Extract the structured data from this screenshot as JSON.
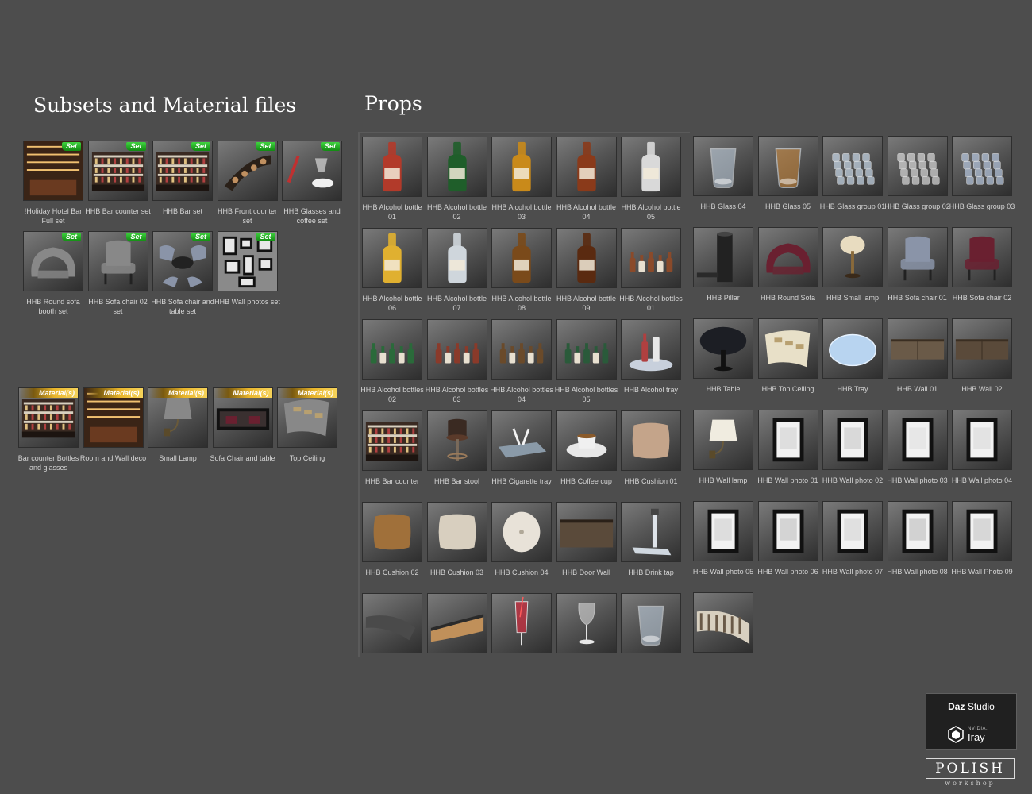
{
  "subsets_title": "Subsets and Material files",
  "props_title": "Props",
  "subsets": [
    {
      "label": "!Holiday Hotel Bar Full set",
      "badge": "Set",
      "icon": "bar-room-icon"
    },
    {
      "label": "HHB Bar counter set",
      "badge": "Set",
      "icon": "bar-counter-icon"
    },
    {
      "label": "HHB Bar set",
      "badge": "Set",
      "icon": "bar-counter-icon"
    },
    {
      "label": "HHB Front counter set",
      "badge": "Set",
      "icon": "front-counter-icon"
    },
    {
      "label": "HHB Glasses and coffee set",
      "badge": "Set",
      "icon": "glasses-coffee-icon"
    },
    {
      "label": "HHB Round sofa booth set",
      "badge": "Set",
      "icon": "sofa-icon"
    },
    {
      "label": "HHB Sofa chair 02 set",
      "badge": "Set",
      "icon": "chair-icon"
    },
    {
      "label": "HHB Sofa chair and table set",
      "badge": "Set",
      "icon": "chair-table-icon"
    },
    {
      "label": "HHB Wall photos set",
      "badge": "Set",
      "icon": "wall-photos-icon"
    }
  ],
  "materials": [
    {
      "label": "Bar counter Bottles and glasses",
      "badge": "Material(s)",
      "icon": "bar-counter-icon"
    },
    {
      "label": "Room and Wall deco",
      "badge": "Material(s)",
      "icon": "bar-room-icon"
    },
    {
      "label": "Small Lamp",
      "badge": "Material(s)",
      "icon": "wall-lamp-icon"
    },
    {
      "label": "Sofa Chair and table",
      "badge": "Material(s)",
      "icon": "sofa-table-icon"
    },
    {
      "label": "Top Ceiling",
      "badge": "Material(s)",
      "icon": "ceiling-icon"
    }
  ],
  "props_left": [
    {
      "label": "HHB Alcohol bottle 01",
      "icon": "bottle-icon",
      "color": "#b23a2a"
    },
    {
      "label": "HHB Alcohol bottle 02",
      "icon": "bottle-icon",
      "color": "#1f5e2a"
    },
    {
      "label": "HHB Alcohol bottle 03",
      "icon": "bottle-icon",
      "color": "#c98a1a"
    },
    {
      "label": "HHB Alcohol bottle 04",
      "icon": "bottle-icon",
      "color": "#8a3a1a"
    },
    {
      "label": "HHB Alcohol bottle 05",
      "icon": "bottle-icon",
      "color": "#d9d9d9"
    },
    {
      "label": "HHB Alcohol bottle 06",
      "icon": "bottle-icon",
      "color": "#e0b030"
    },
    {
      "label": "HHB Alcohol bottle 07",
      "icon": "bottle-icon",
      "color": "#cfd6dc"
    },
    {
      "label": "HHB Alcohol bottle 08",
      "icon": "bottle-icon",
      "color": "#7a4a1a"
    },
    {
      "label": "HHB Alcohol bottle 09",
      "icon": "bottle-icon",
      "color": "#5a2a10"
    },
    {
      "label": "HHB Alcohol bottles 01",
      "icon": "bottles-icon",
      "color": "#8a4a2a"
    },
    {
      "label": "HHB Alcohol bottles 02",
      "icon": "bottles-icon",
      "color": "#2a6a3a"
    },
    {
      "label": "HHB Alcohol bottles 03",
      "icon": "bottles-icon",
      "color": "#8a3a2a"
    },
    {
      "label": "HHB Alcohol bottles 04",
      "icon": "bottles-icon",
      "color": "#6a4a2a"
    },
    {
      "label": "HHB Alcohol bottles 05",
      "icon": "bottles-icon",
      "color": "#2a5a3a"
    },
    {
      "label": "HHB Alcohol tray",
      "icon": "tray-bottles-icon",
      "color": "#b04040"
    },
    {
      "label": "HHB Bar counter",
      "icon": "bar-counter-icon",
      "color": "#a06a3a"
    },
    {
      "label": "HHB Bar stool",
      "icon": "bar-stool-icon",
      "color": "#3a2a22"
    },
    {
      "label": "HHB Cigarette tray",
      "icon": "cigarette-tray-icon",
      "color": "#8a9aa8"
    },
    {
      "label": "HHB Coffee cup",
      "icon": "coffee-cup-icon",
      "color": "#f0f0f0"
    },
    {
      "label": "HHB Cushion 01",
      "icon": "cushion-icon",
      "color": "#c4a48a"
    },
    {
      "label": "HHB Cushion 02",
      "icon": "cushion-icon",
      "color": "#a0703a"
    },
    {
      "label": "HHB Cushion 03",
      "icon": "cushion-icon",
      "color": "#d8cfbf"
    },
    {
      "label": "HHB Cushion 04",
      "icon": "round-cushion-icon",
      "color": "#e8e2d8"
    },
    {
      "label": "HHB Door Wall",
      "icon": "door-wall-icon",
      "color": "#5a4a3a"
    },
    {
      "label": "HHB Drink tap",
      "icon": "drink-tap-icon",
      "color": "#d0d8e0"
    },
    {
      "label": "",
      "icon": "curved-panel-icon",
      "color": "#4a4a4a"
    },
    {
      "label": "",
      "icon": "curved-counter-icon",
      "color": "#c0905a"
    },
    {
      "label": "",
      "icon": "cocktail-glass-icon",
      "color": "#c03040"
    },
    {
      "label": "",
      "icon": "wine-glass-icon",
      "color": "#d8d8d8"
    },
    {
      "label": "",
      "icon": "glass-icon",
      "color": "#c8d8e8"
    }
  ],
  "props_right": [
    {
      "label": "HHB Glass 04",
      "icon": "glass-icon",
      "color": "#c8d8e8"
    },
    {
      "label": "HHB Glass 05",
      "icon": "glass-icon",
      "color": "#d08a3a"
    },
    {
      "label": "HHB Glass group 01",
      "icon": "glass-group-icon",
      "color": "#c8d8e8"
    },
    {
      "label": "HHB Glass group 02",
      "icon": "glass-group-icon",
      "color": "#d8d8d8"
    },
    {
      "label": "HHB Glass group 03",
      "icon": "glass-group-icon",
      "color": "#b8c8e0"
    },
    {
      "label": "HHB Pillar",
      "icon": "pillar-icon",
      "color": "#222222"
    },
    {
      "label": "HHB Round Sofa",
      "icon": "sofa-icon",
      "color": "#6a2030"
    },
    {
      "label": "HHB Small lamp",
      "icon": "table-lamp-icon",
      "color": "#e8dcc0"
    },
    {
      "label": "HHB Sofa chair 01",
      "icon": "chair-icon",
      "color": "#8a94a8"
    },
    {
      "label": "HHB Sofa chair 02",
      "icon": "chair-icon",
      "color": "#6a2030"
    },
    {
      "label": "HHB Table",
      "icon": "table-icon",
      "color": "#1c1e24"
    },
    {
      "label": "HHB Top Ceiling",
      "icon": "ceiling-icon",
      "color": "#e8e0c8"
    },
    {
      "label": "HHB Tray",
      "icon": "tray-icon",
      "color": "#b8d4f0"
    },
    {
      "label": "HHB Wall 01",
      "icon": "wall-panel-icon",
      "color": "#6a5a48"
    },
    {
      "label": "HHB Wall 02",
      "icon": "wall-panel-icon",
      "color": "#5a4a3a"
    },
    {
      "label": "HHB Wall lamp",
      "icon": "wall-lamp-icon",
      "color": "#f0ece0"
    },
    {
      "label": "HHB Wall photo 01",
      "icon": "photo-frame-icon",
      "color": "#d0d0d0"
    },
    {
      "label": "HHB Wall photo 02",
      "icon": "photo-frame-icon",
      "color": "#c8c8c8"
    },
    {
      "label": "HHB Wall photo 03",
      "icon": "photo-frame-icon",
      "color": "#e0e0e0"
    },
    {
      "label": "HHB Wall photo 04",
      "icon": "photo-frame-icon",
      "color": "#d8d8d8"
    },
    {
      "label": "HHB Wall photo 05",
      "icon": "photo-frame-icon",
      "color": "#cfcfcf"
    },
    {
      "label": "HHB Wall photo 06",
      "icon": "photo-frame-icon",
      "color": "#c0c0c0"
    },
    {
      "label": "HHB Wall photo 07",
      "icon": "photo-frame-icon",
      "color": "#d4d4d4"
    },
    {
      "label": "HHB Wall photo 08",
      "icon": "photo-frame-icon",
      "color": "#bcbcbc"
    },
    {
      "label": "HHB Wall Photo 09",
      "icon": "photo-frame-icon",
      "color": "#c4c4c4"
    },
    {
      "label": "",
      "icon": "curved-wall-icon",
      "color": "#d8d0c0"
    }
  ],
  "logos": {
    "daz_bold": "Daz",
    "daz_rest": " Studio",
    "nvidia": "NVIDIA.",
    "iray": "Iray",
    "polish": "POLISH",
    "workshop": "workshop"
  }
}
